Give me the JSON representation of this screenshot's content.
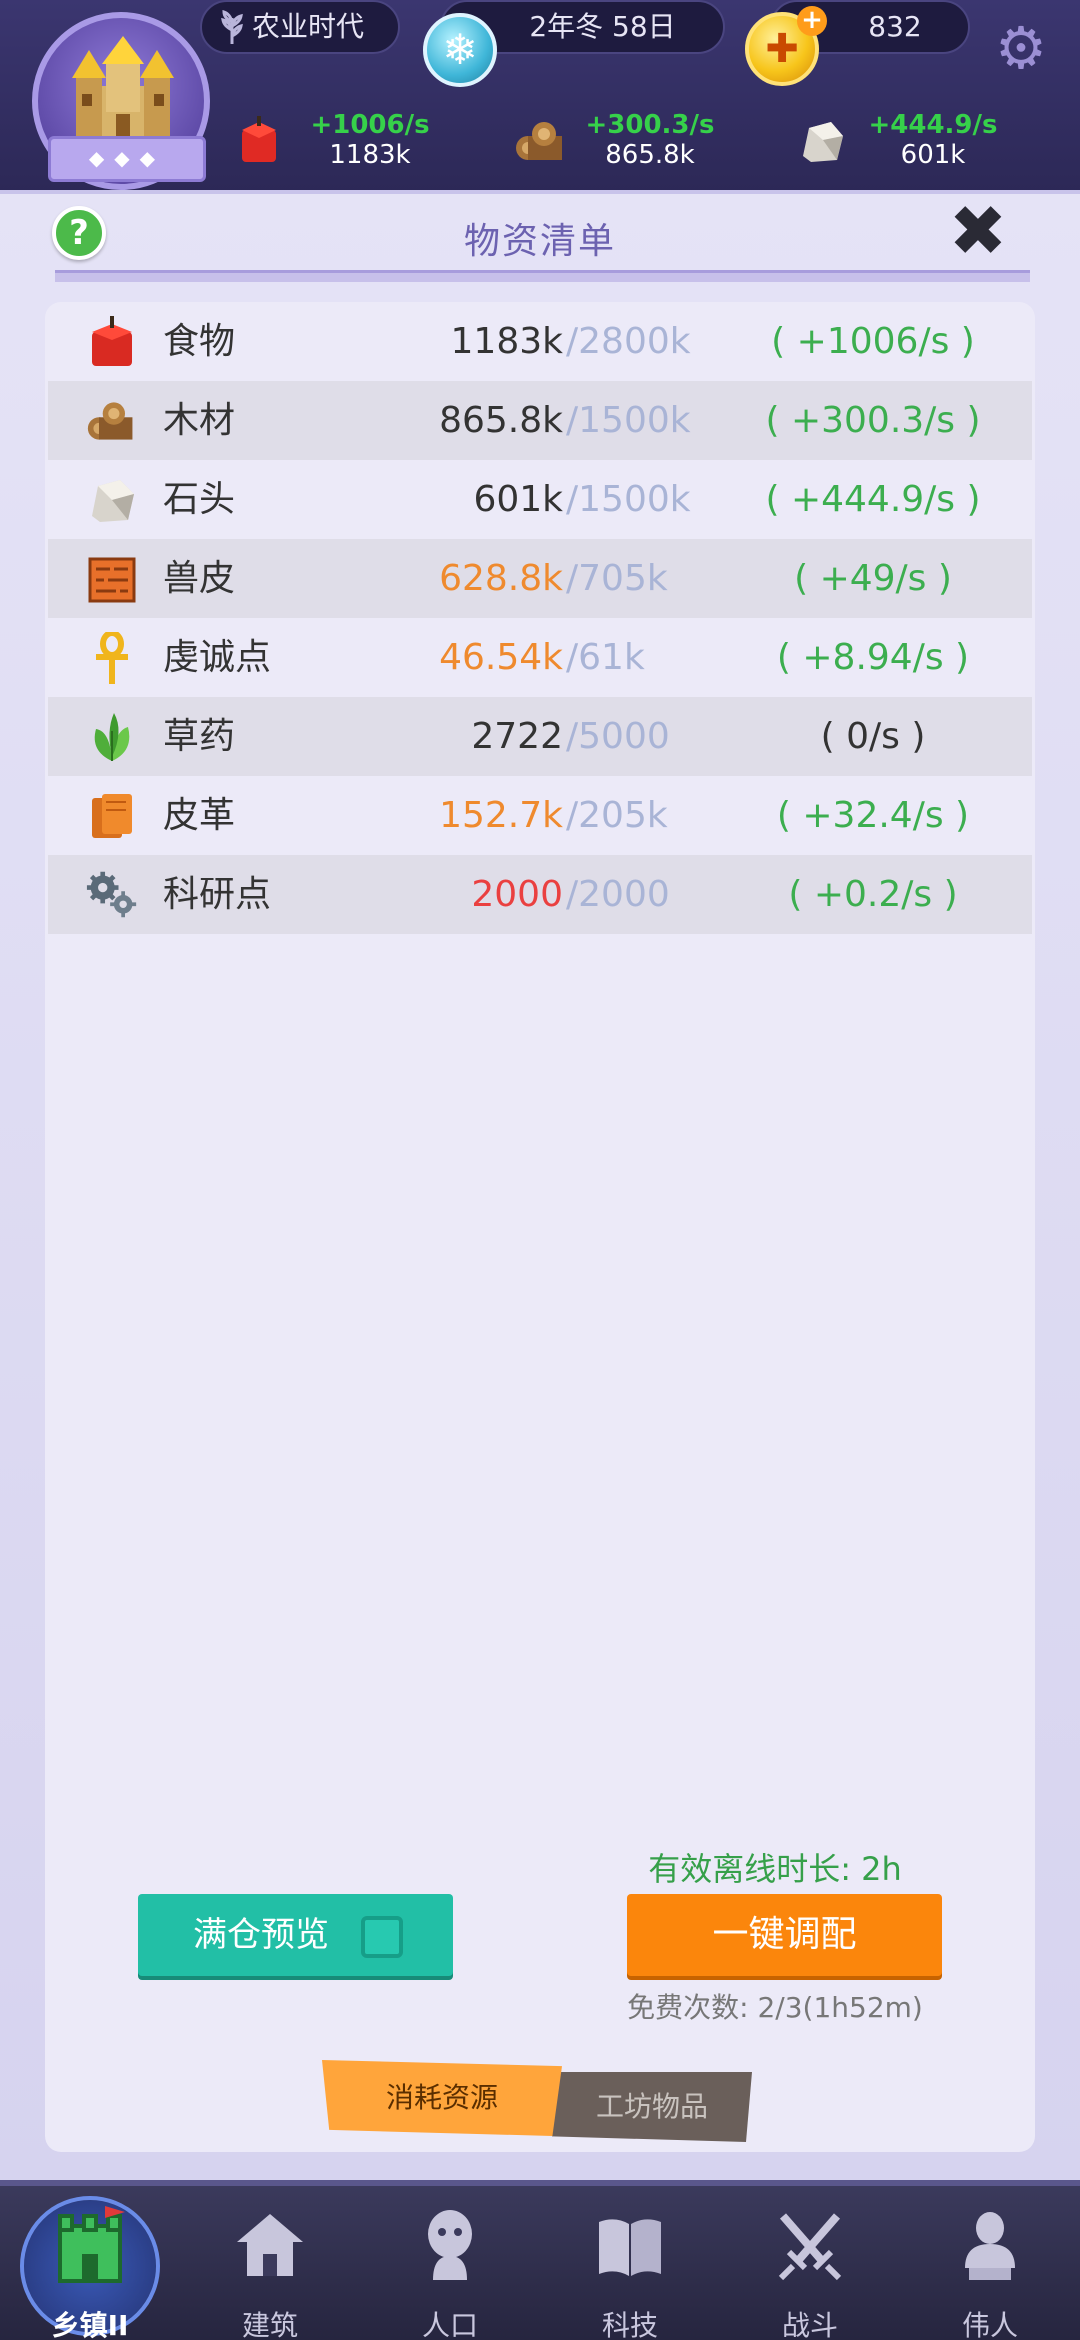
{
  "hud": {
    "era_label": "农业时代",
    "date_label": "2年冬 58日",
    "gold_amount": "832",
    "resources": [
      {
        "icon": "food-icon",
        "rate": "+1006/s",
        "amount": "1183k"
      },
      {
        "icon": "wood-icon",
        "rate": "+300.3/s",
        "amount": "865.8k"
      },
      {
        "icon": "stone-icon",
        "rate": "+444.9/s",
        "amount": "601k"
      }
    ]
  },
  "panel": {
    "title": "物资清单",
    "help_glyph": "?",
    "close_glyph": "✖",
    "rows": [
      {
        "icon": "apple-icon",
        "name": "食物",
        "current": "1183k",
        "cap": "/2800k",
        "rate": "( +1006/s )",
        "status": "normal"
      },
      {
        "icon": "wood-logs-icon",
        "name": "木材",
        "current": "865.8k",
        "cap": "/1500k",
        "rate": "( +300.3/s )",
        "status": "normal"
      },
      {
        "icon": "stone-icon",
        "name": "石头",
        "current": "601k",
        "cap": "/1500k",
        "rate": "( +444.9/s )",
        "status": "normal"
      },
      {
        "icon": "hide-icon",
        "name": "兽皮",
        "current": "628.8k",
        "cap": "/705k",
        "rate": "( +49/s )",
        "status": "warn"
      },
      {
        "icon": "ankh-icon",
        "name": "虔诚点",
        "current": "46.54k",
        "cap": "/61k",
        "rate": "( +8.94/s )",
        "status": "warn"
      },
      {
        "icon": "herb-icon",
        "name": "草药",
        "current": "2722",
        "cap": "/5000",
        "rate": "( 0/s )",
        "status": "normal"
      },
      {
        "icon": "leather-icon",
        "name": "皮革",
        "current": "152.7k",
        "cap": "/205k",
        "rate": "( +32.4/s )",
        "status": "warn"
      },
      {
        "icon": "gears-icon",
        "name": "科研点",
        "current": "2000",
        "cap": "/2000",
        "rate": "( +0.2/s )",
        "status": "full"
      }
    ],
    "offline_duration": "有效离线时长: 2h",
    "preview_button": "满仓预览",
    "allocate_button": "一键调配",
    "free_count": "免费次数: 2/3(1h52m)",
    "tabs": {
      "consume": "消耗资源",
      "workshop": "工坊物品"
    }
  },
  "nav": [
    {
      "label": "乡镇II",
      "icon": "town-icon",
      "active": true
    },
    {
      "label": "建筑",
      "icon": "house-icon",
      "active": false
    },
    {
      "label": "人口",
      "icon": "person-icon",
      "active": false
    },
    {
      "label": "科技",
      "icon": "book-icon",
      "active": false
    },
    {
      "label": "战斗",
      "icon": "swords-icon",
      "active": false
    },
    {
      "label": "伟人",
      "icon": "bust-icon",
      "active": false
    }
  ],
  "colors": {
    "rate_green": "#3cae4f",
    "warn_orange": "#ef8a2e",
    "full_red": "#ea4040",
    "allocate_orange": "#fb860c",
    "preview_teal": "#22bfa6"
  }
}
